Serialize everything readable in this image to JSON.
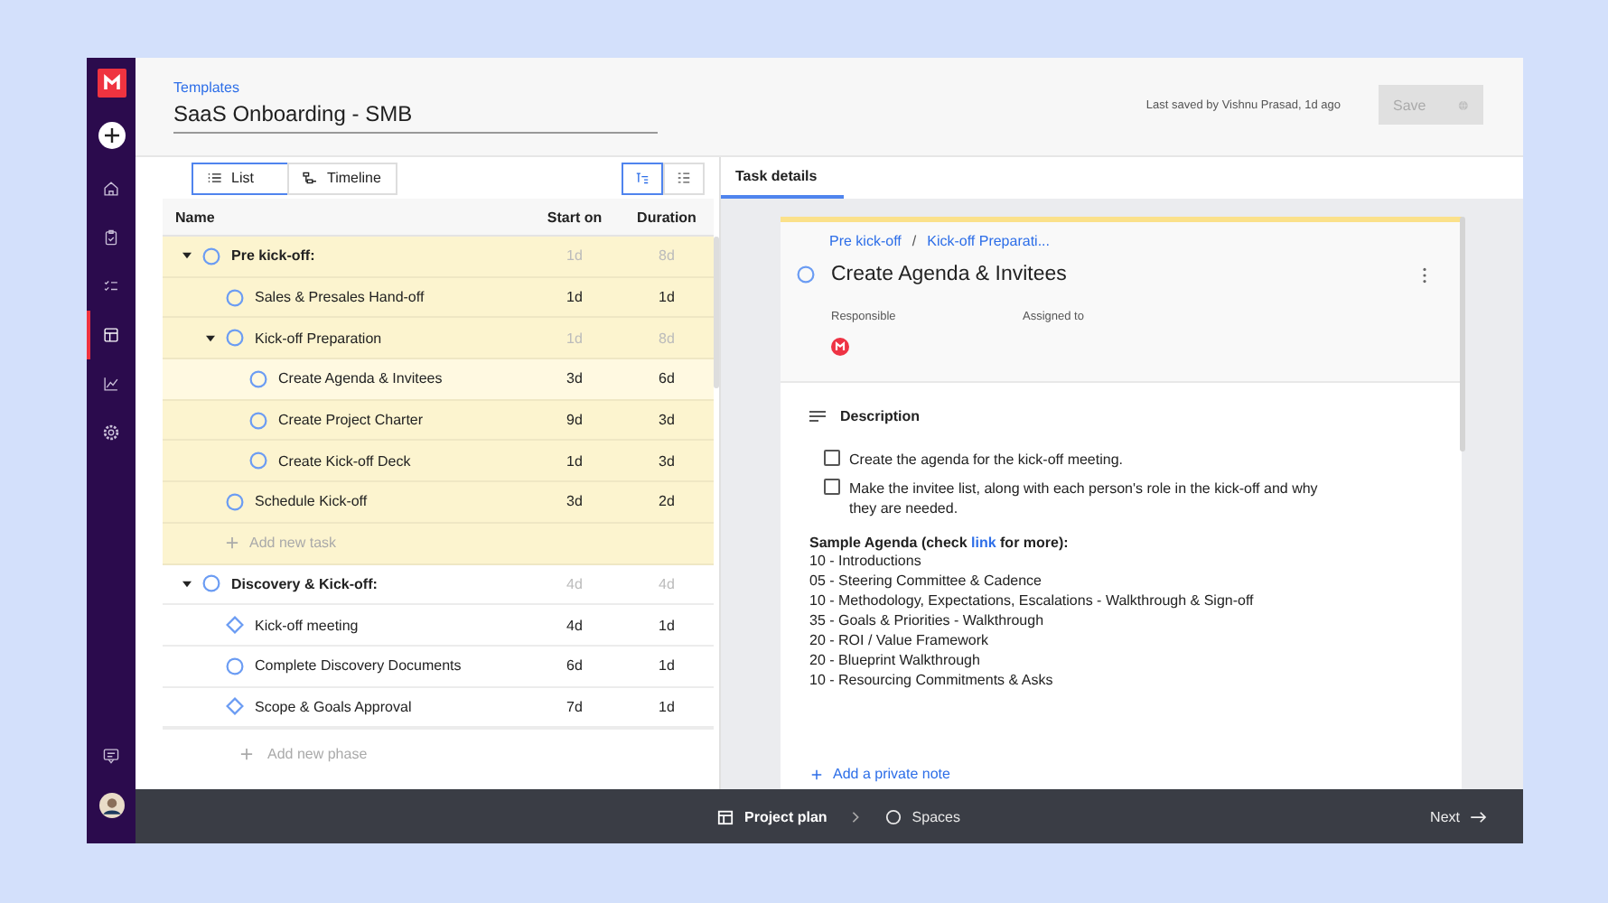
{
  "sidebar": {
    "items": [
      {
        "kind": "add",
        "selected": false
      },
      {
        "kind": "home",
        "selected": false
      },
      {
        "kind": "clipboard",
        "selected": false
      },
      {
        "kind": "checklist",
        "selected": false
      },
      {
        "kind": "templates",
        "selected": true
      },
      {
        "kind": "chart",
        "selected": false
      },
      {
        "kind": "settings",
        "selected": false
      }
    ]
  },
  "header": {
    "breadcrumb": "Templates",
    "title": "SaaS Onboarding - SMB",
    "last_saved": "Last saved by Vishnu Prasad, 1d ago",
    "save_button": {
      "label": "Save",
      "disabled": true
    }
  },
  "views": [
    {
      "label": "List",
      "kind": "list",
      "selected": true
    },
    {
      "label": "Timeline",
      "kind": "timeline",
      "selected": false
    }
  ],
  "layout_toggles": [
    {
      "kind": "tree",
      "selected": true
    },
    {
      "kind": "flat",
      "selected": false
    }
  ],
  "table": {
    "columns": [
      "Name",
      "Start on",
      "Duration"
    ],
    "phases": [
      {
        "name": "Pre kick-off:",
        "start": "1d",
        "duration": "8d",
        "expanded": true,
        "highlighted": true,
        "selected": false,
        "add_task": "Add new task",
        "children": [
          {
            "name": "Sales & Presales Hand-off",
            "kind": "task",
            "start": "1d",
            "duration": "1d",
            "selected": false
          },
          {
            "name": "Kick-off Preparation",
            "kind": "task",
            "start": "1d",
            "duration": "8d",
            "selected": false,
            "expanded": true,
            "children": [
              {
                "name": "Create Agenda & Invitees",
                "kind": "task",
                "start": "3d",
                "duration": "6d",
                "selected": true
              },
              {
                "name": "Create Project Charter",
                "kind": "task",
                "start": "9d",
                "duration": "3d",
                "selected": false
              },
              {
                "name": "Create Kick-off Deck",
                "kind": "task",
                "start": "1d",
                "duration": "3d",
                "selected": false
              }
            ]
          },
          {
            "name": "Schedule Kick-off",
            "kind": "task",
            "start": "3d",
            "duration": "2d",
            "selected": false
          }
        ]
      },
      {
        "name": "Discovery & Kick-off:",
        "start": "4d",
        "duration": "4d",
        "expanded": true,
        "highlighted": false,
        "selected": false,
        "children": [
          {
            "name": "Kick-off meeting",
            "kind": "milestone",
            "start": "4d",
            "duration": "1d",
            "selected": false
          },
          {
            "name": "Complete Discovery Documents",
            "kind": "task",
            "start": "6d",
            "duration": "1d",
            "selected": false
          },
          {
            "name": "Scope & Goals Approval",
            "kind": "milestone",
            "start": "7d",
            "duration": "1d",
            "selected": false
          }
        ]
      }
    ],
    "add_phase": "Add new phase"
  },
  "details": {
    "tabs": [
      {
        "label": "Task details",
        "selected": true
      }
    ],
    "breadcrumb": {
      "items": [
        "Pre kick-off",
        "Kick-off Preparati..."
      ],
      "separator": "/"
    },
    "title": "Create Agenda & Invitees",
    "fields": [
      {
        "label": "Responsible",
        "has_avatar": true
      },
      {
        "label": "Assigned to",
        "has_avatar": false
      }
    ],
    "description": {
      "heading": "Description",
      "checklist": [
        {
          "text": "Create the agenda for the kick-off meeting.",
          "checked": false
        },
        {
          "text": "Make the invitee list, along with each person's role in the kick-off and why they are needed.",
          "checked": false
        }
      ],
      "agenda_heading": {
        "before": "Sample Agenda (check",
        "link": "link",
        "after": "for more):"
      },
      "agenda_lines": [
        "10 - Introductions",
        "05 - Steering Committee & Cadence",
        "10 - Methodology, Expectations, Escalations - Walkthrough & Sign-off",
        "35 - Goals & Priorities - Walkthrough",
        "20 - ROI / Value Framework",
        "20 - Blueprint Walkthrough",
        "10 - Resourcing Commitments & Asks"
      ]
    },
    "add_note": "Add a private note"
  },
  "bottom_bar": {
    "steps": [
      {
        "label": "Project plan",
        "kind": "plan",
        "selected": true
      },
      {
        "label": "Spaces",
        "kind": "spaces",
        "selected": false
      }
    ],
    "next": "Next"
  }
}
